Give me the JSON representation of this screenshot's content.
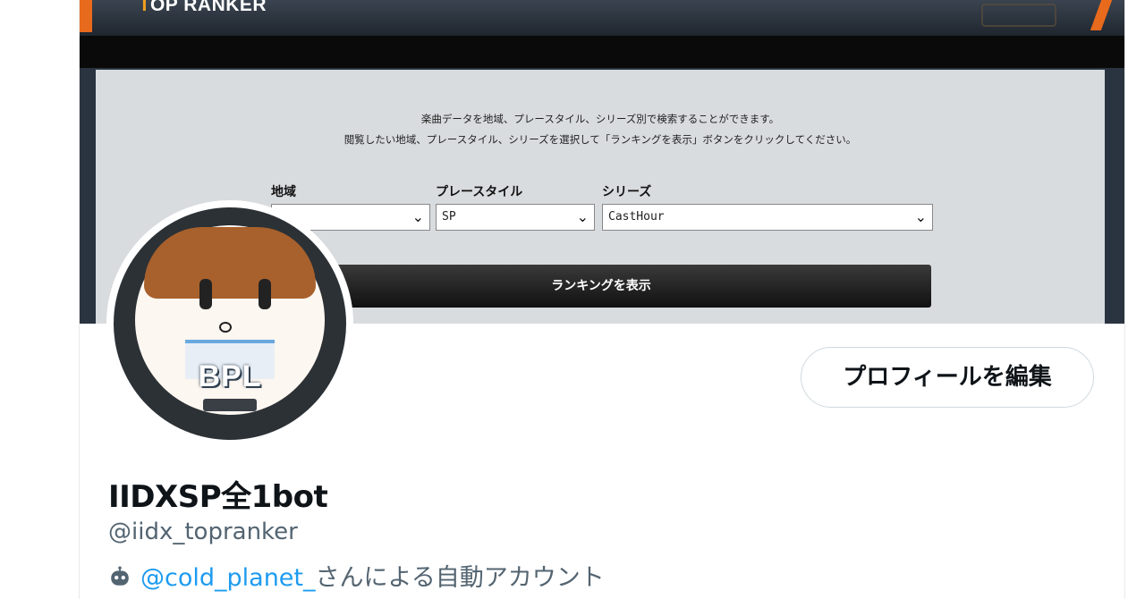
{
  "banner": {
    "title_first_letter": "T",
    "title_rest": "OP RANKER",
    "description_line1": "楽曲データを地域、プレースタイル、シリーズ別で検索することができます。",
    "description_line2": "閲覧したい地域、プレースタイル、シリーズを選択して「ランキングを表示」ボタンをクリックしてください。",
    "region_label": "地域",
    "region_value": "",
    "playstyle_label": "プレースタイル",
    "playstyle_value": "SP",
    "series_label": "シリーズ",
    "series_value": "CastHour",
    "show_ranking_button": "ランキングを表示"
  },
  "avatar": {
    "logo_text": "BPL",
    "icon": "avatar-icon"
  },
  "profile": {
    "edit_button": "プロフィールを編集",
    "display_name": "IIDXSP全1bot",
    "handle": "@iidx_topranker",
    "automated_owner": "@cold_planet_",
    "automated_suffix": "さんによる自動アカウント"
  },
  "colors": {
    "accent": "#1d9bf0",
    "secondary_text": "#536471",
    "primary_text": "#0f1419"
  }
}
